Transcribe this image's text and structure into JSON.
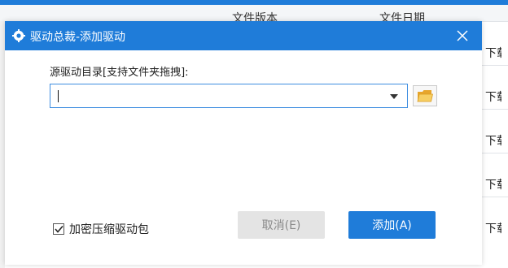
{
  "background": {
    "column_headers": [
      "文件版本",
      "文件日期"
    ],
    "row_action_label": "下载",
    "row_count": 5
  },
  "dialog": {
    "title": "驱动总裁-添加驱动",
    "source_label": "源驱动目录[支持文件夹拖拽]:",
    "source_value": "",
    "compress_label": "加密压缩驱动包",
    "compress_checked": true,
    "cancel_label": "取消(E)",
    "add_label": "添加(A)"
  },
  "colors": {
    "accent": "#1f7cd9",
    "title_text": "#ffffff",
    "disabled_button": "#e4e4e4",
    "folder_icon": "#f0b93a"
  },
  "icons": {
    "title": "gear-icon",
    "close": "close-icon",
    "dropdown": "chevron-down-icon",
    "browse": "folder-open-icon",
    "check": "checkmark-icon"
  }
}
